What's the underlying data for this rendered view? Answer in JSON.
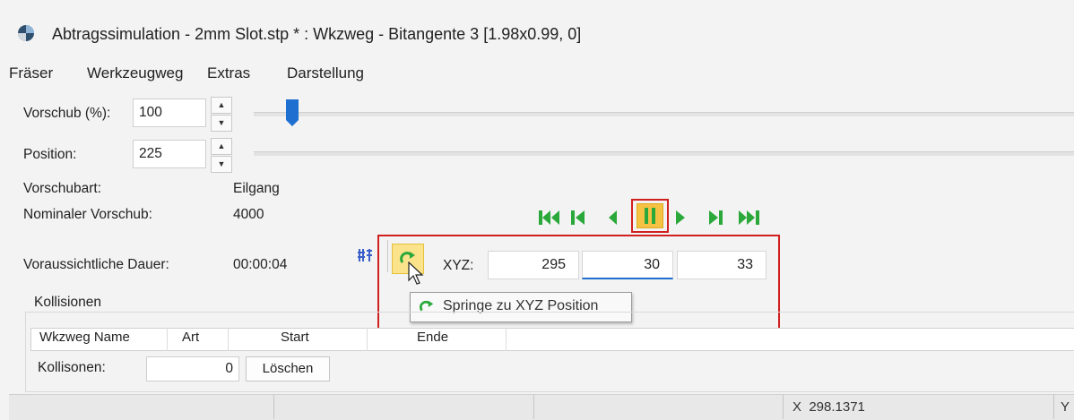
{
  "window": {
    "title": "Abtragssimulation - 2mm Slot.stp * : Wkzweg - Bitangente 3 [1.98x0.99, 0]"
  },
  "menu": [
    "Fräser",
    "Werkzeugweg",
    "Extras",
    "Darstellung"
  ],
  "controls": {
    "vorschub_label": "Vorschub (%):",
    "vorschub_value": "100",
    "vorschub_slider_fraction": 0.0,
    "position_label": "Position:",
    "position_value": "225"
  },
  "info": {
    "vorschubart_label": "Vorschubart:",
    "vorschubart_value": "Eilgang",
    "nominaler_label": "Nominaler Vorschub:",
    "nominaler_value": "4000",
    "dauer_label": "Voraussichtliche Dauer:",
    "dauer_value": "00:00:04"
  },
  "playback": {
    "buttons": [
      "to-start",
      "step-back-segment",
      "step-back",
      "pause",
      "play",
      "step-forward-segment",
      "to-end"
    ],
    "active": "pause",
    "accent_color": "#2aa83a"
  },
  "xyz": {
    "label": "XYZ:",
    "x": "295",
    "y": "30",
    "z": "33"
  },
  "tooltip": {
    "text": "Springe zu XYZ Position"
  },
  "collisions": {
    "group_label": "Kollisionen",
    "columns": [
      "Wkzweg Name",
      "Art",
      "Start",
      "Ende"
    ],
    "count_label": "Kollisonen:",
    "count_value": "0",
    "clear_button": "Löschen"
  },
  "statusbar": {
    "x_readout": "X  298.1371",
    "y_readout": "Y"
  },
  "colors": {
    "highlight_border": "#d11f1f",
    "slider_thumb": "#1e6fd0",
    "pause_bg": "#f6c243"
  }
}
